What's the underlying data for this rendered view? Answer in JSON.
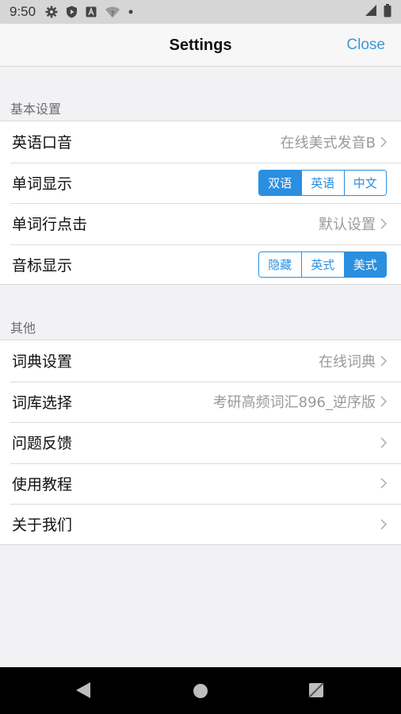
{
  "status_bar": {
    "time": "9:50",
    "icons": [
      "settings-gear-icon",
      "shield-play-icon",
      "a-box-icon",
      "wifi-question-icon",
      "dot-icon"
    ],
    "right_icons": [
      "cell-signal-icon",
      "battery-icon"
    ]
  },
  "nav": {
    "title": "Settings",
    "close_label": "Close"
  },
  "sections": [
    {
      "header": "基本设置",
      "rows": [
        {
          "label": "英语口音",
          "value": "在线美式发音B"
        },
        {
          "label": "单词显示",
          "options": [
            "双语",
            "英语",
            "中文"
          ],
          "selected": "双语"
        },
        {
          "label": "单词行点击",
          "value": "默认设置"
        },
        {
          "label": "音标显示",
          "options": [
            "隐藏",
            "英式",
            "美式"
          ],
          "selected": "美式"
        }
      ]
    },
    {
      "header": "其他",
      "rows": [
        {
          "label": "词典设置",
          "value": "在线词典"
        },
        {
          "label": "词库选择",
          "value": "考研高频词汇896_逆序版"
        },
        {
          "label": "问题反馈",
          "value": ""
        },
        {
          "label": "使用教程",
          "value": ""
        },
        {
          "label": "关于我们",
          "value": ""
        }
      ]
    }
  ],
  "system_nav": [
    "back-icon",
    "home-icon",
    "recents-icon"
  ],
  "colors": {
    "accent": "#2a8fe0",
    "close_link": "#3a9ad9",
    "background": "#f2f2f4",
    "secondary_text": "#9a9a9a"
  }
}
